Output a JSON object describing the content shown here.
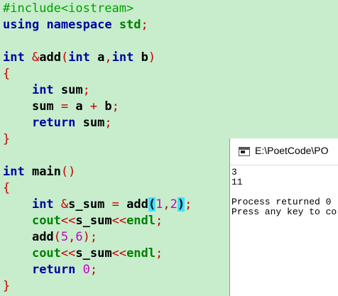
{
  "editor": {
    "line1": [
      {
        "t": "#include<iostream>",
        "c": "k-pre"
      }
    ],
    "line2": [
      {
        "t": "using",
        "c": "k-blue"
      },
      {
        "t": " "
      },
      {
        "t": "namespace",
        "c": "k-blue"
      },
      {
        "t": " "
      },
      {
        "t": "std",
        "c": "k-green"
      },
      {
        "t": ";",
        "c": "k-red"
      }
    ],
    "line4": [
      {
        "t": "int",
        "c": "k-blue"
      },
      {
        "t": " "
      },
      {
        "t": "&",
        "c": "k-red"
      },
      {
        "t": "add",
        "c": "k-plain"
      },
      {
        "t": "(",
        "c": "k-red"
      },
      {
        "t": "int",
        "c": "k-blue"
      },
      {
        "t": " a",
        "c": "k-plain"
      },
      {
        "t": ",",
        "c": "k-red"
      },
      {
        "t": "int",
        "c": "k-blue"
      },
      {
        "t": " b",
        "c": "k-plain"
      },
      {
        "t": ")",
        "c": "k-red"
      }
    ],
    "line5": [
      {
        "t": "{",
        "c": "k-red"
      }
    ],
    "line6": [
      {
        "t": "    "
      },
      {
        "t": "int",
        "c": "k-blue"
      },
      {
        "t": " sum",
        "c": "k-plain"
      },
      {
        "t": ";",
        "c": "k-red"
      }
    ],
    "line7": [
      {
        "t": "    "
      },
      {
        "t": "sum",
        "c": "k-plain"
      },
      {
        "t": " "
      },
      {
        "t": "=",
        "c": "k-red"
      },
      {
        "t": " a ",
        "c": "k-plain"
      },
      {
        "t": "+",
        "c": "k-red"
      },
      {
        "t": " b",
        "c": "k-plain"
      },
      {
        "t": ";",
        "c": "k-red"
      }
    ],
    "line8": [
      {
        "t": "    "
      },
      {
        "t": "return",
        "c": "k-blue"
      },
      {
        "t": " sum",
        "c": "k-plain"
      },
      {
        "t": ";",
        "c": "k-red"
      }
    ],
    "line9": [
      {
        "t": "}",
        "c": "k-red"
      }
    ],
    "line11": [
      {
        "t": "int",
        "c": "k-blue"
      },
      {
        "t": " main",
        "c": "k-plain"
      },
      {
        "t": "()",
        "c": "k-red"
      }
    ],
    "line12": [
      {
        "t": "{",
        "c": "k-red"
      }
    ],
    "line13": [
      {
        "t": "    "
      },
      {
        "t": "int",
        "c": "k-blue"
      },
      {
        "t": " "
      },
      {
        "t": "&",
        "c": "k-red"
      },
      {
        "t": "s_sum",
        "c": "k-plain"
      },
      {
        "t": " "
      },
      {
        "t": "=",
        "c": "k-red"
      },
      {
        "t": " add",
        "c": "k-plain"
      },
      {
        "t": "(",
        "c": "k-hl"
      },
      {
        "t": "1",
        "c": "k-num"
      },
      {
        "t": ",",
        "c": "k-red"
      },
      {
        "t": "2",
        "c": "k-num"
      },
      {
        "t": ")",
        "c": "k-hl"
      },
      {
        "t": ";",
        "c": "k-red"
      }
    ],
    "line14": [
      {
        "t": "    "
      },
      {
        "t": "cout",
        "c": "k-green"
      },
      {
        "t": "<<",
        "c": "k-red"
      },
      {
        "t": "s_sum",
        "c": "k-plain"
      },
      {
        "t": "<<",
        "c": "k-red"
      },
      {
        "t": "endl",
        "c": "k-green"
      },
      {
        "t": ";",
        "c": "k-red"
      }
    ],
    "line15": [
      {
        "t": "    "
      },
      {
        "t": "add",
        "c": "k-plain"
      },
      {
        "t": "(",
        "c": "k-red"
      },
      {
        "t": "5",
        "c": "k-num"
      },
      {
        "t": ",",
        "c": "k-red"
      },
      {
        "t": "6",
        "c": "k-num"
      },
      {
        "t": ")",
        "c": "k-red"
      },
      {
        "t": ";",
        "c": "k-red"
      }
    ],
    "line16": [
      {
        "t": "    "
      },
      {
        "t": "cout",
        "c": "k-green"
      },
      {
        "t": "<<",
        "c": "k-red"
      },
      {
        "t": "s_sum",
        "c": "k-plain"
      },
      {
        "t": "<<",
        "c": "k-red"
      },
      {
        "t": "endl",
        "c": "k-green"
      },
      {
        "t": ";",
        "c": "k-red"
      }
    ],
    "line17": [
      {
        "t": "    "
      },
      {
        "t": "return",
        "c": "k-blue"
      },
      {
        "t": " "
      },
      {
        "t": "0",
        "c": "k-num"
      },
      {
        "t": ";",
        "c": "k-red"
      }
    ],
    "line18": [
      {
        "t": "}",
        "c": "k-red"
      }
    ]
  },
  "console": {
    "title": "E:\\PoetCode\\PO",
    "icon": "console-window-icon",
    "output": {
      "out1": "3",
      "out2": "11",
      "out3": "",
      "out4": "Process returned 0",
      "out5": "Press any key to co"
    }
  },
  "colors": {
    "background": "#c7edcc",
    "keyword": "#0000a0",
    "preprocessor": "#00a000",
    "operator": "#c80000",
    "number": "#c800c8",
    "bracket_highlight": "#40e0ff"
  }
}
